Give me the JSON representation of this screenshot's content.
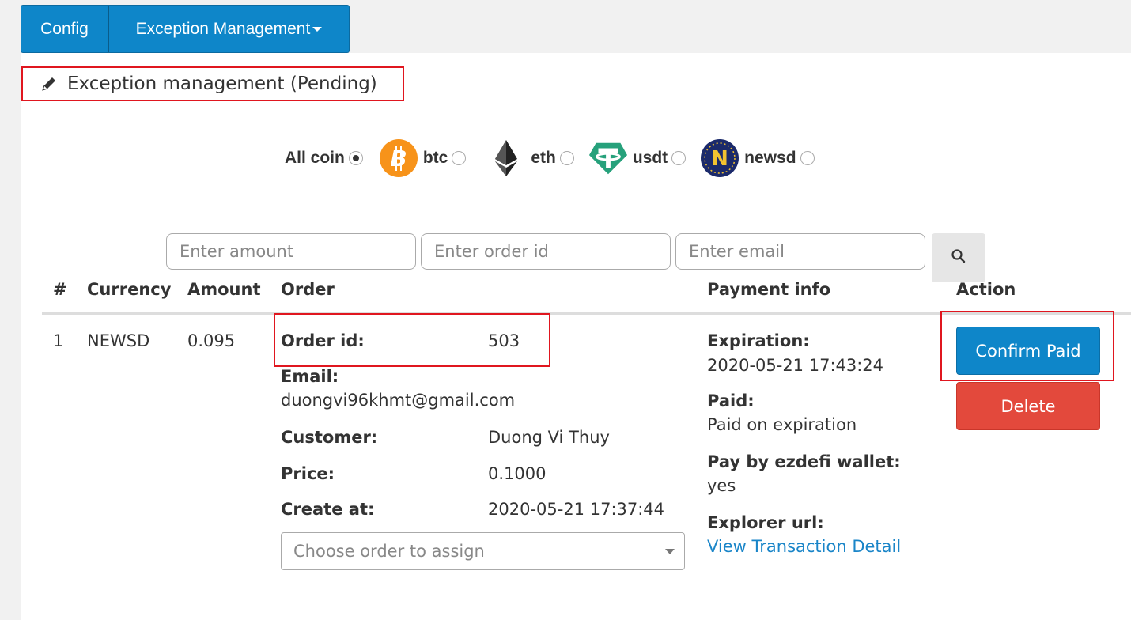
{
  "nav": {
    "config_label": "Config",
    "exception_label": "Exception Management"
  },
  "heading": {
    "title": "Exception management (Pending)",
    "icon": "pencil-icon"
  },
  "coins": {
    "all_label": "All coin",
    "items": [
      {
        "label": "btc",
        "icon": "bitcoin-icon",
        "color": "#f7931a"
      },
      {
        "label": "eth",
        "icon": "ethereum-icon",
        "color": "#222222"
      },
      {
        "label": "usdt",
        "icon": "tether-icon",
        "color": "#26a17b"
      },
      {
        "label": "newsd",
        "icon": "newsd-icon",
        "color": "#1b2a6b"
      }
    ],
    "selected": "All coin"
  },
  "search": {
    "amount_placeholder": "Enter amount",
    "order_placeholder": "Enter order id",
    "email_placeholder": "Enter email",
    "icon": "search-icon"
  },
  "table": {
    "headers": [
      "#",
      "Currency",
      "Amount",
      "Order",
      "Payment info",
      "Action"
    ],
    "row": {
      "index": "1",
      "currency": "NEWSD",
      "amount": "0.095",
      "order_id_label": "Order id:",
      "order_id": "503",
      "email_label": "Email:",
      "email": "duongvi96khmt@gmail.com",
      "customer_label": "Customer:",
      "customer": "Duong Vi Thuy",
      "price_label": "Price:",
      "price": "0.1000",
      "create_label": "Create at:",
      "create_at": "2020-05-21 17:37:44",
      "assign_placeholder": "Choose order to assign",
      "expiration_label": "Expiration:",
      "expiration": "2020-05-21 17:43:24",
      "paid_label": "Paid:",
      "paid": "Paid on expiration",
      "wallet_label": "Pay by ezdefi wallet:",
      "wallet": "yes",
      "explorer_label": "Explorer url:",
      "explorer_link": "View Transaction Detail",
      "confirm_label": "Confirm Paid",
      "delete_label": "Delete"
    }
  },
  "colors": {
    "primary": "#0e86c9",
    "danger": "#e3493c",
    "highlight": "#e0161f"
  }
}
